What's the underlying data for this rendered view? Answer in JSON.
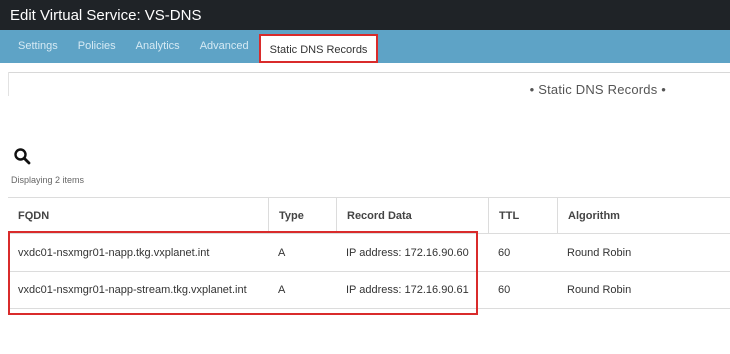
{
  "window": {
    "title": "Edit Virtual Service: VS-DNS"
  },
  "tabs": [
    {
      "label": "Settings"
    },
    {
      "label": "Policies"
    },
    {
      "label": "Analytics"
    },
    {
      "label": "Advanced"
    },
    {
      "label": "Static DNS Records",
      "active": true
    }
  ],
  "section": {
    "heading": "• Static DNS Records •"
  },
  "search": {
    "icon": "search-icon"
  },
  "grid": {
    "count_text": "Displaying 2 items",
    "columns": [
      "FQDN",
      "Type",
      "Record Data",
      "TTL",
      "Algorithm"
    ],
    "rows": [
      {
        "fqdn": "vxdc01-nsxmgr01-napp.tkg.vxplanet.int",
        "type": "A",
        "record_data": "IP address: 172.16.90.60",
        "ttl": "60",
        "algorithm": "Round Robin"
      },
      {
        "fqdn": "vxdc01-nsxmgr01-napp-stream.tkg.vxplanet.int",
        "type": "A",
        "record_data": "IP address: 172.16.90.61",
        "ttl": "60",
        "algorithm": "Round Robin"
      }
    ]
  },
  "colors": {
    "titlebar": "#1f2327",
    "tabbar": "#5ea3c6",
    "highlight": "#d92b2b"
  }
}
